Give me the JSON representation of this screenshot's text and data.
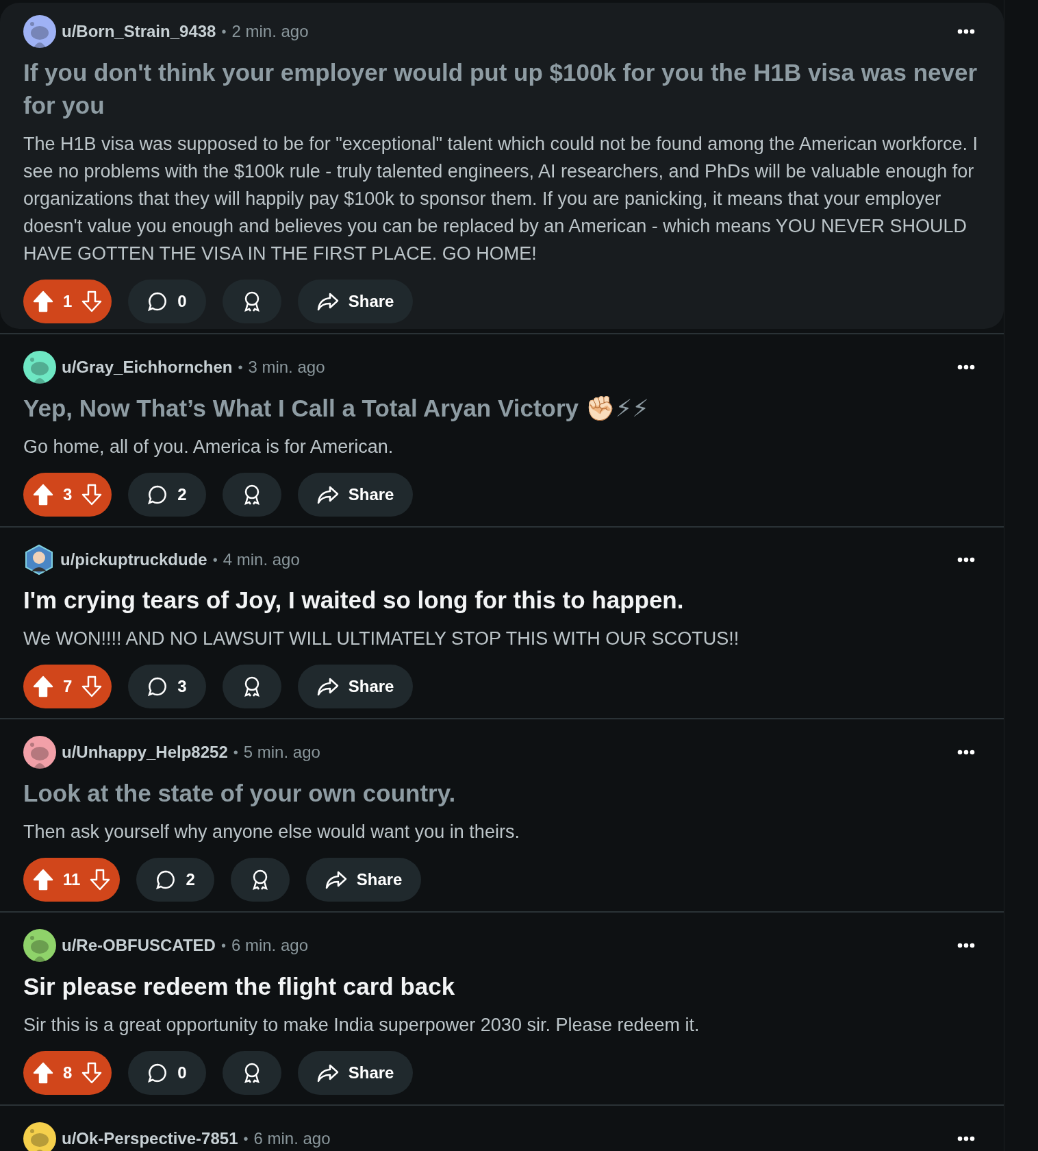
{
  "posts": [
    {
      "author": "u/Born_Strain_9438",
      "separator": "•",
      "time": "2 min. ago",
      "avatar": {
        "kind": "snoo",
        "color": "#9fb2f5"
      },
      "highlighted": true,
      "visited": true,
      "title": "If you don't think your employer would put up $100k for you the H1B visa was never for you",
      "body": "The H1B visa was supposed to be for \"exceptional\" talent which could not be found among the American workforce. I see no problems with the $100k rule - truly talented engineers, AI researchers, and PhDs will be valuable enough for organizations that they will happily pay $100k to sponsor them. If you are panicking, it means that your employer doesn't value you enough and believes you can be replaced by an American - which means YOU NEVER SHOULD HAVE GOTTEN THE VISA IN THE FIRST PLACE. GO HOME!",
      "score": "1",
      "upvoted": true,
      "comments": "0",
      "share": "Share"
    },
    {
      "author": "u/Gray_Eichhornchen",
      "separator": "•",
      "time": "3 min. ago",
      "avatar": {
        "kind": "snoo",
        "color": "#6ee7c3"
      },
      "highlighted": false,
      "visited": true,
      "title": "Yep, Now That’s What I Call a Total Aryan Victory ✊🏻⚡⚡",
      "body": "Go home, all of you. America is for American.",
      "score": "3",
      "upvoted": true,
      "comments": "2",
      "share": "Share"
    },
    {
      "author": "u/pickuptruckdude",
      "separator": "•",
      "time": "4 min. ago",
      "avatar": {
        "kind": "custom",
        "color": "#4a86c5"
      },
      "highlighted": false,
      "visited": false,
      "title": "I'm crying tears of Joy, I waited so long for this to happen.",
      "body": "We WON!!!! AND NO LAWSUIT WILL ULTIMATELY STOP THIS WITH OUR SCOTUS!!",
      "score": "7",
      "upvoted": true,
      "comments": "3",
      "share": "Share"
    },
    {
      "author": "u/Unhappy_Help8252",
      "separator": "•",
      "time": "5 min. ago",
      "avatar": {
        "kind": "snoo",
        "color": "#f2a0a8"
      },
      "highlighted": false,
      "visited": true,
      "title": "Look at the state of your own country.",
      "body": "Then ask yourself why anyone else would want you in theirs.",
      "score": "11",
      "upvoted": true,
      "comments": "2",
      "share": "Share"
    },
    {
      "author": "u/Re-OBFUSCATED",
      "separator": "•",
      "time": "6 min. ago",
      "avatar": {
        "kind": "snoo",
        "color": "#8fd36a"
      },
      "highlighted": false,
      "visited": false,
      "title": "Sir please redeem the flight card back",
      "body": "Sir this is a great opportunity to make India superpower 2030 sir. Please redeem it.",
      "score": "8",
      "upvoted": true,
      "comments": "0",
      "share": "Share"
    },
    {
      "author": "u/Ok-Perspective-7851",
      "separator": "•",
      "time": "6 min. ago",
      "avatar": {
        "kind": "snoo",
        "color": "#f5d04c"
      },
      "highlighted": false
    }
  ]
}
